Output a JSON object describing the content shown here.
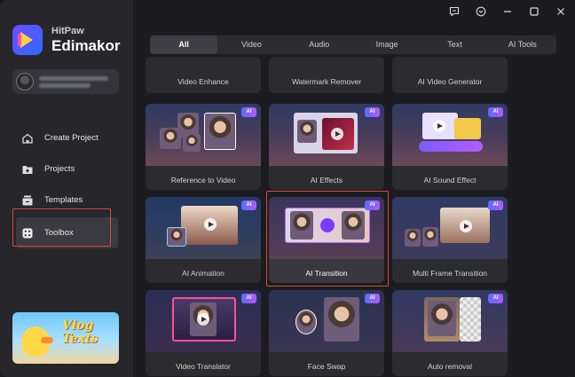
{
  "sidebar": {
    "brand_name": "HitPaw",
    "brand_product": "Edimakor",
    "banner_text": "Vlog Texts",
    "nav": [
      {
        "label": "Create Project",
        "icon": "home-icon"
      },
      {
        "label": "Projects",
        "icon": "folder-plus-icon"
      },
      {
        "label": "Templates",
        "icon": "templates-icon"
      },
      {
        "label": "Toolbox",
        "icon": "toolbox-icon"
      }
    ],
    "active": "Toolbox"
  },
  "tabs": [
    "All",
    "Video",
    "Audio",
    "Image",
    "Text",
    "AI Tools"
  ],
  "active_tab": "All",
  "ai_badge": "AI",
  "tools": [
    {
      "label": "Video Enhance",
      "ai": false
    },
    {
      "label": "Watermark Remover",
      "ai": false
    },
    {
      "label": "AI Video Generator",
      "ai": false
    },
    {
      "label": "Reference to Video",
      "ai": true
    },
    {
      "label": "AI Effects",
      "ai": true
    },
    {
      "label": "AI Sound Effect",
      "ai": true
    },
    {
      "label": "AI Animation",
      "ai": true
    },
    {
      "label": "AI Transition",
      "ai": true,
      "selected": true
    },
    {
      "label": "Multi Frame Transition",
      "ai": true
    },
    {
      "label": "Video Translator",
      "ai": true
    },
    {
      "label": "Face Swap",
      "ai": true
    },
    {
      "label": "Auto removal",
      "ai": true
    }
  ],
  "colors": {
    "accent_red": "#e1453a",
    "badge_start": "#5b6bff",
    "badge_end": "#b05bff"
  }
}
